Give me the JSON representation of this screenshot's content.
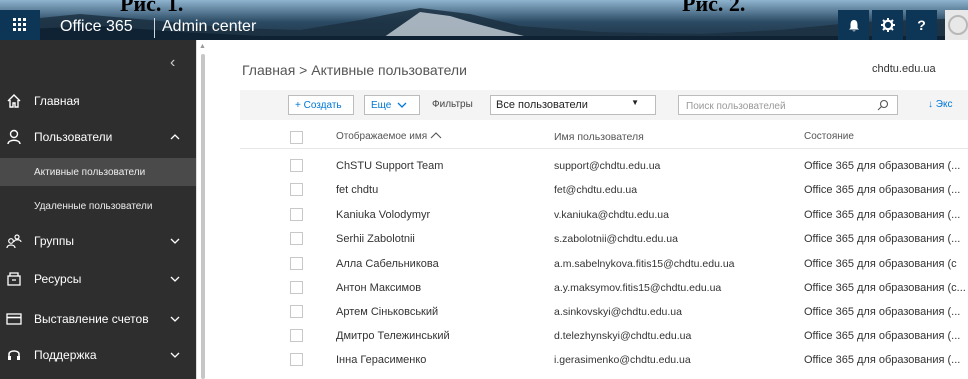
{
  "captions": {
    "left": "Рис. 1.",
    "right": "Рис. 2."
  },
  "header": {
    "brand": "Office 365",
    "section": "Admin center",
    "icons": [
      "app-launcher-icon",
      "bell-icon",
      "gear-icon",
      "help-icon",
      "avatar"
    ],
    "help_label": "?"
  },
  "sidebar": {
    "items": [
      {
        "label": "Главная",
        "icon": "home-icon"
      },
      {
        "label": "Пользователи",
        "icon": "user-icon",
        "expanded": true
      },
      {
        "label": "Активные пользователи",
        "sub": true,
        "active": true
      },
      {
        "label": "Удаленные пользователи",
        "sub": true
      },
      {
        "label": "Группы",
        "icon": "group-icon"
      },
      {
        "label": "Ресурсы",
        "icon": "resources-icon"
      },
      {
        "label": "Выставление счетов",
        "icon": "billing-icon"
      },
      {
        "label": "Поддержка",
        "icon": "support-icon"
      }
    ]
  },
  "main": {
    "breadcrumb": "Главная > Активные пользователи",
    "domain": "chdtu.edu.ua",
    "toolbar": {
      "create": "+ Создать",
      "more": "Еще",
      "filters_label": "Фильтры",
      "filter_value": "Все пользователи",
      "search_placeholder": "Поиск пользователей",
      "export": "↓ Экс"
    },
    "table": {
      "columns": [
        "Отображаемое имя",
        "Имя пользователя",
        "Состояние"
      ],
      "sort_column": "Отображаемое имя",
      "sort_direction": "asc",
      "rows": [
        {
          "name": "ChSTU Support Team",
          "user": "support@chdtu.edu.ua",
          "state": "Office 365 для образования (..."
        },
        {
          "name": "fet chdtu",
          "user": "fet@chdtu.edu.ua",
          "state": "Office 365 для образования (..."
        },
        {
          "name": "Kaniuka Volodymyr",
          "user": "v.kaniuka@chdtu.edu.ua",
          "state": "Office 365 для образования (..."
        },
        {
          "name": "Serhii Zabolotnii",
          "user": "s.zabolotnii@chdtu.edu.ua",
          "state": "Office 365 для образования (..."
        },
        {
          "name": "Алла Сабельникова",
          "user": "a.m.sabelnykova.fitis15@chdtu.edu.ua",
          "state": "Office 365 для образования (c"
        },
        {
          "name": "Антон Максимов",
          "user": "a.y.maksymov.fitis15@chdtu.edu.ua",
          "state": "Office 365 для образования (c..."
        },
        {
          "name": "Артем Сіньковський",
          "user": "a.sinkovskyi@chdtu.edu.ua",
          "state": "Office 365 для образования (..."
        },
        {
          "name": "Дмитро Тележинський",
          "user": "d.telezhynskyi@chdtu.edu.ua",
          "state": "Office 365 для образования (..."
        },
        {
          "name": "Інна Герасименко",
          "user": "i.gerasimenko@chdtu.edu.ua",
          "state": "Office 365 для образования (..."
        }
      ]
    }
  },
  "colors": {
    "accent": "#0078d7",
    "sidebar": "#2e2e2e",
    "header_dark": "#0d3556"
  }
}
